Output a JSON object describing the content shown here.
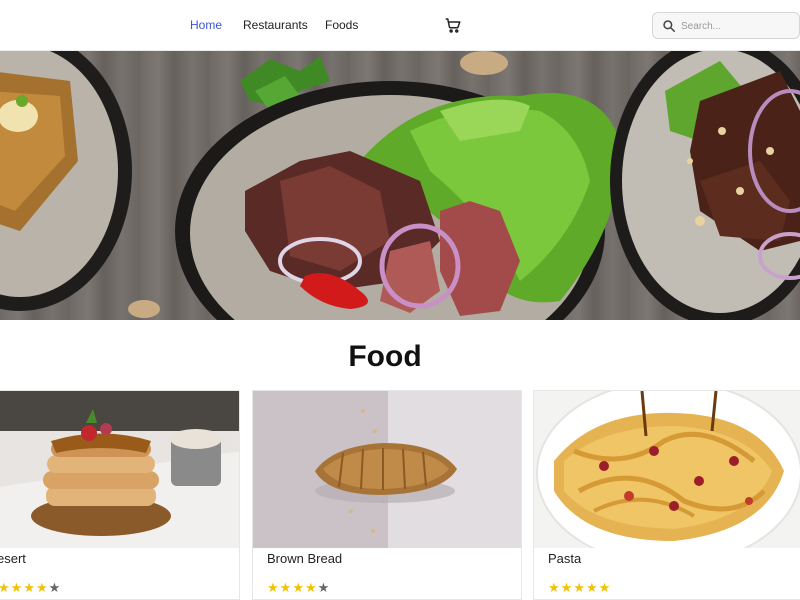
{
  "nav": {
    "links": [
      {
        "label": "Home",
        "active": true
      },
      {
        "label": "Restaurants",
        "active": false
      },
      {
        "label": "Foods",
        "active": false
      }
    ],
    "cart_icon": "shopping-cart-icon",
    "search": {
      "placeholder": "Search...",
      "value": "",
      "icon": "search-icon"
    }
  },
  "hero": {
    "image": "steak-salad-plates-banner"
  },
  "section": {
    "title": "Food"
  },
  "cards": [
    {
      "name": "esert",
      "image": "pancake-stack",
      "rating": 4,
      "max_rating": 5
    },
    {
      "name": "Brown Bread",
      "image": "bread-loaf",
      "rating": 4,
      "max_rating": 5
    },
    {
      "name": "Pasta",
      "image": "pasta-plate",
      "rating": 5,
      "max_rating": 5
    }
  ],
  "colors": {
    "accent": "#3a56d4",
    "star": "#f2c200",
    "star_empty": "#666666"
  }
}
